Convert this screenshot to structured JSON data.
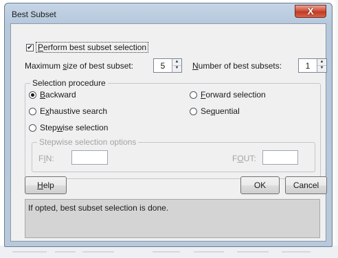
{
  "window": {
    "title": "Best Subset",
    "close_label": "X"
  },
  "perform": {
    "checked": true,
    "check_mark": "✔",
    "label_first": "P",
    "label_rest": "erform best subset selection"
  },
  "max_size": {
    "label_start": "Maximum ",
    "label_key": "s",
    "label_end": "ize of best subset:",
    "value": "5"
  },
  "num_subsets": {
    "label_key": "N",
    "label_end": "umber of best subsets:",
    "value": "1"
  },
  "procedure": {
    "legend": "Selection procedure",
    "options": {
      "backward": {
        "key": "B",
        "rest": "ackward",
        "selected": true
      },
      "exhaustive": {
        "start": "E",
        "key": "x",
        "rest": "haustive search",
        "selected": false
      },
      "stepwise": {
        "start": "Step",
        "key": "w",
        "rest": "ise selection",
        "selected": false
      },
      "forward": {
        "key": "F",
        "rest": "orward selection",
        "selected": false
      },
      "sequential": {
        "start": "Se",
        "key": "q",
        "rest": "uential",
        "selected": false
      }
    }
  },
  "stepwise_options": {
    "legend": "Stepwise selection options",
    "fin": {
      "start": "F",
      "key": "I",
      "rest": "N:"
    },
    "fout": {
      "start": "F",
      "key": "O",
      "rest": "UT:"
    }
  },
  "buttons": {
    "help": {
      "key": "H",
      "rest": "elp"
    },
    "ok": "OK",
    "cancel": "Cancel"
  },
  "status_text": "If opted, best subset selection is done.",
  "colors": {
    "frame": "#b8c9dc",
    "close": "#c13a23",
    "client": "#f0f0f0",
    "status_bg": "#d4d4d4"
  }
}
